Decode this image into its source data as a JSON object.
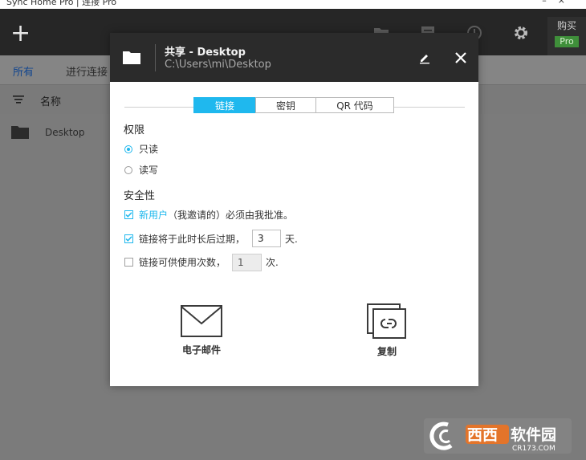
{
  "window": {
    "title": "Sync Home Pro | 连接 Pro",
    "buy_label": "购买",
    "pro_badge": "Pro"
  },
  "toolbar": {
    "icons": [
      "add-icon",
      "folder-icon",
      "list-icon",
      "history-icon",
      "gear-icon"
    ]
  },
  "tabs": [
    {
      "label": "所有",
      "active": true
    },
    {
      "label": "进行连接",
      "active": false
    }
  ],
  "file_list": {
    "column_name": "名称",
    "items": [
      {
        "name": "Desktop"
      }
    ]
  },
  "share_dialog": {
    "title": "共享 - Desktop",
    "path": "C:\\Users\\mi\\Desktop",
    "tabs": [
      {
        "label": "链接",
        "active": true
      },
      {
        "label": "密钥",
        "active": false
      },
      {
        "label": "QR 代码",
        "active": false
      }
    ],
    "permissions": {
      "heading": "权限",
      "options": [
        {
          "label": "只读",
          "selected": true
        },
        {
          "label": "读写",
          "selected": false
        }
      ]
    },
    "security": {
      "heading": "安全性",
      "approve_new_users": {
        "link_label": "新用户",
        "suffix": "（我邀请的）必须由我批准。",
        "checked": true
      },
      "expire": {
        "label": "链接将于此时长后过期，",
        "value": "3",
        "unit": "天.",
        "checked": true
      },
      "use_limit": {
        "label": "链接可供使用次数，",
        "value": "1",
        "unit": "次.",
        "checked": false
      }
    },
    "actions": [
      {
        "label": "电子邮件",
        "icon": "mail-icon"
      },
      {
        "label": "复制",
        "icon": "copy-link-icon"
      }
    ]
  },
  "watermark": {
    "text": "西西软件园",
    "url_text": "CR173.COM"
  },
  "colors": {
    "accent": "#1fb8ee",
    "header_dark": "#2b2b2b",
    "toolbar_dark": "#262626",
    "pro_green": "#3f8f3a"
  }
}
